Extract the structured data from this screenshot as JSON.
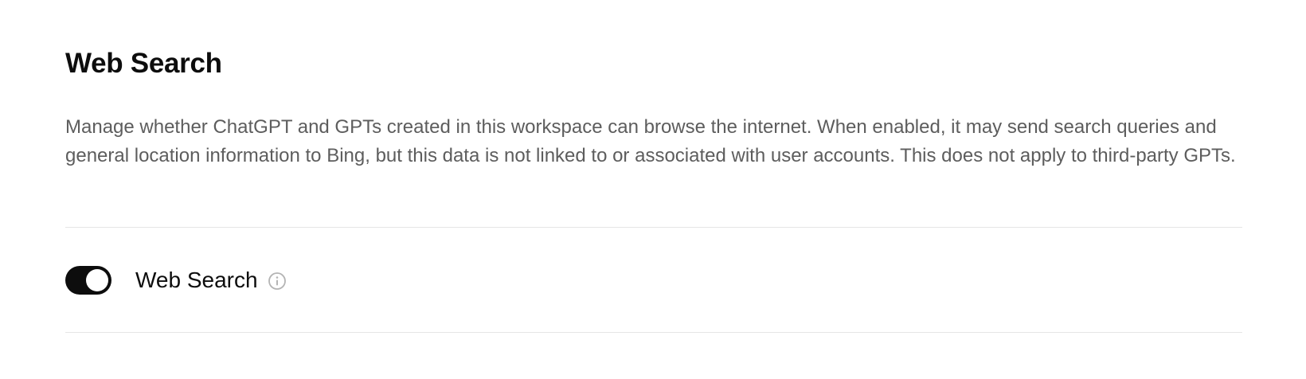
{
  "section": {
    "title": "Web Search",
    "description": "Manage whether ChatGPT and GPTs created in this workspace can browse the internet. When enabled, it may send search queries and general location information to Bing, but this data is not linked to or associated with user accounts. This does not apply to third-party GPTs."
  },
  "setting": {
    "label": "Web Search",
    "enabled": true,
    "toggle_icon": "toggle-switch",
    "info_icon": "info-circle-icon"
  },
  "colors": {
    "toggle_on": "#0d0d0d",
    "text_primary": "#0d0d0d",
    "text_secondary": "#5d5d5d",
    "divider": "#e6e6e6",
    "info_icon": "#b4b4b4"
  }
}
